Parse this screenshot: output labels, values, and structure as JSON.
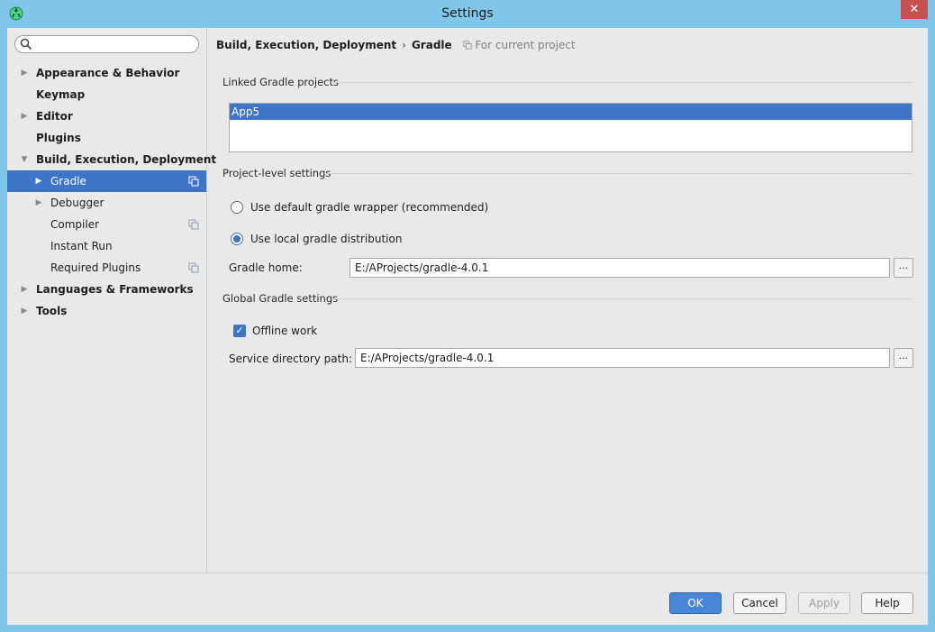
{
  "window": {
    "title": "Settings",
    "close_glyph": "✕"
  },
  "search": {
    "placeholder": "",
    "value": ""
  },
  "sidebar": {
    "items": [
      {
        "label": "Appearance & Behavior",
        "arrow": "▶"
      },
      {
        "label": "Keymap",
        "arrow": ""
      },
      {
        "label": "Editor",
        "arrow": "▶"
      },
      {
        "label": "Plugins",
        "arrow": ""
      },
      {
        "label": "Build, Execution, Deployment",
        "arrow": "▼"
      },
      {
        "label": "Gradle",
        "arrow": "▶"
      },
      {
        "label": "Debugger",
        "arrow": "▶"
      },
      {
        "label": "Compiler",
        "arrow": ""
      },
      {
        "label": "Instant Run",
        "arrow": ""
      },
      {
        "label": "Required Plugins",
        "arrow": ""
      },
      {
        "label": "Languages & Frameworks",
        "arrow": "▶"
      },
      {
        "label": "Tools",
        "arrow": "▶"
      }
    ],
    "selected": "Gradle"
  },
  "breadcrumb": {
    "parent": "Build, Execution, Deployment",
    "separator": "›",
    "current": "Gradle",
    "scope": "For current project"
  },
  "linked_projects": {
    "title": "Linked Gradle projects",
    "items": [
      "App5"
    ]
  },
  "project_level": {
    "title": "Project-level settings",
    "option_wrapper": "Use default gradle wrapper (recommended)",
    "option_local": "Use local gradle distribution",
    "gradle_home_label": "Gradle home:",
    "gradle_home_value": "E:/AProjects/gradle-4.0.1",
    "browse": "..."
  },
  "global": {
    "title": "Global Gradle settings",
    "offline_label": "Offline work",
    "check_glyph": "✓",
    "service_dir_label": "Service directory path:",
    "service_dir_value": "E:/AProjects/gradle-4.0.1",
    "browse": "..."
  },
  "buttons": {
    "ok": "OK",
    "cancel": "Cancel",
    "apply": "Apply",
    "help": "Help"
  },
  "colors": {
    "accent": "#3d76c9",
    "titlebar": "#7fc6ea",
    "close": "#c75050"
  }
}
